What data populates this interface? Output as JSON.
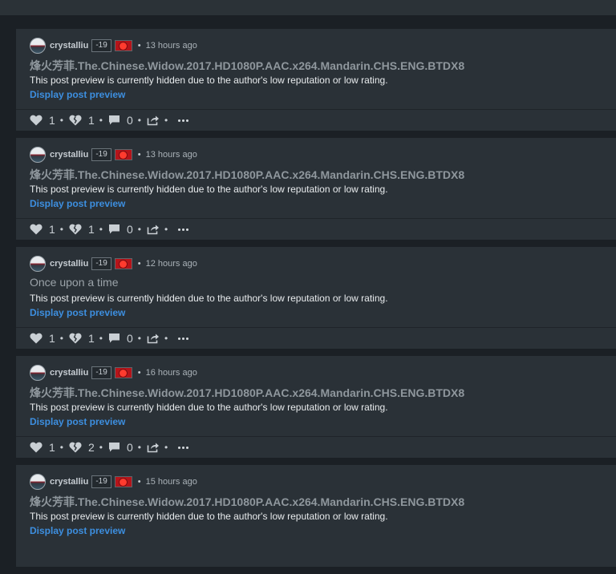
{
  "feed": {
    "posts": [
      {
        "author": "crystalliu",
        "reputation": "-19",
        "time": "13 hours ago",
        "title": "烽火芳菲.The.Chinese.Widow.2017.HD1080P.AAC.x264.Mandarin.CHS.ENG.BTDX8",
        "notice": "This post preview is currently hidden due to the author's low reputation or low rating.",
        "link": "Display post preview",
        "upvotes": "1",
        "downvotes": "1",
        "comments": "0"
      },
      {
        "author": "crystalliu",
        "reputation": "-19",
        "time": "13 hours ago",
        "title": "烽火芳菲.The.Chinese.Widow.2017.HD1080P.AAC.x264.Mandarin.CHS.ENG.BTDX8",
        "notice": "This post preview is currently hidden due to the author's low reputation or low rating.",
        "link": "Display post preview",
        "upvotes": "1",
        "downvotes": "1",
        "comments": "0"
      },
      {
        "author": "crystalliu",
        "reputation": "-19",
        "time": "12 hours ago",
        "title": "Once upon a time",
        "notice": "This post preview is currently hidden due to the author's low reputation or low rating.",
        "link": "Display post preview",
        "upvotes": "1",
        "downvotes": "1",
        "comments": "0"
      },
      {
        "author": "crystalliu",
        "reputation": "-19",
        "time": "16 hours ago",
        "title": "烽火芳菲.The.Chinese.Widow.2017.HD1080P.AAC.x264.Mandarin.CHS.ENG.BTDX8",
        "notice": "This post preview is currently hidden due to the author's low reputation or low rating.",
        "link": "Display post preview",
        "upvotes": "1",
        "downvotes": "2",
        "comments": "0"
      },
      {
        "author": "crystalliu",
        "reputation": "-19",
        "time": "15 hours ago",
        "title": "烽火芳菲.The.Chinese.Widow.2017.HD1080P.AAC.x264.Mandarin.CHS.ENG.BTDX8",
        "notice": "This post preview is currently hidden due to the author's low reputation or low rating.",
        "link": "Display post preview",
        "upvotes": "",
        "downvotes": "",
        "comments": ""
      }
    ],
    "separator": "•",
    "icons": {
      "upvote": "heart-icon",
      "downvote": "broken-heart-icon",
      "comments": "comment-bubble-icon",
      "share": "share-icon",
      "more": "more-dots-icon",
      "flag": "china-flag-icon"
    }
  },
  "colors": {
    "background": "#1b2025",
    "card": "#2a3137",
    "link": "#3d8fe0",
    "title": "#8f979d",
    "flag": "#b5141a"
  }
}
